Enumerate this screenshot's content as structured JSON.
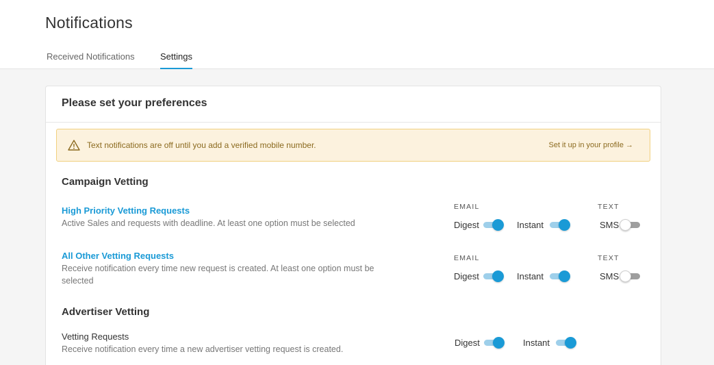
{
  "page": {
    "title": "Notifications"
  },
  "tabs": [
    {
      "label": "Received Notifications",
      "active": false
    },
    {
      "label": "Settings",
      "active": true
    }
  ],
  "card": {
    "title": "Please set your preferences"
  },
  "alert": {
    "icon": "warning-triangle-icon",
    "text": "Text notifications are off until you add a verified mobile number.",
    "link": "Set it up in your profile →"
  },
  "sections": {
    "campaign": {
      "title": "Campaign Vetting",
      "items": [
        {
          "title": "High Priority Vetting Requests",
          "desc": "Active Sales and requests with deadline. At least one option must be selected",
          "email_label": "EMAIL",
          "text_label": "TEXT",
          "digest_label": "Digest",
          "instant_label": "Instant",
          "sms_label": "SMS",
          "digest_on": true,
          "instant_on": true,
          "sms_on": false
        },
        {
          "title": "All Other Vetting Requests",
          "desc": "Receive notification every time new request is created. At least one option must be selected",
          "email_label": "EMAIL",
          "text_label": "TEXT",
          "digest_label": "Digest",
          "instant_label": "Instant",
          "sms_label": "SMS",
          "digest_on": true,
          "instant_on": true,
          "sms_on": false
        }
      ]
    },
    "advertiser": {
      "title": "Advertiser Vetting",
      "items": [
        {
          "title": "Vetting Requests",
          "desc": "Receive notification every time a new advertiser vetting request is created.",
          "digest_label": "Digest",
          "instant_label": "Instant",
          "digest_on": true,
          "instant_on": true
        }
      ]
    }
  },
  "colors": {
    "accent": "#1a9ad6",
    "alert_bg": "#fcf2de",
    "alert_border": "#f1d07f",
    "alert_text": "#8b6a1f"
  }
}
